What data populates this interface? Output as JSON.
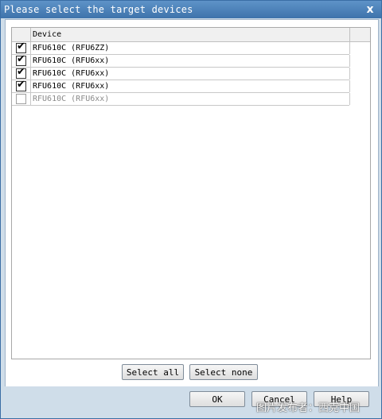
{
  "window": {
    "title": "Please select the target devices",
    "close_label": "x"
  },
  "list": {
    "header": "Device",
    "rows": [
      {
        "label": "RFU610C (RFU6ZZ)",
        "checked": true,
        "enabled": true
      },
      {
        "label": "RFU610C (RFU6xx)",
        "checked": true,
        "enabled": true
      },
      {
        "label": "RFU610C (RFU6xx)",
        "checked": true,
        "enabled": true
      },
      {
        "label": "RFU610C (RFU6xx)",
        "checked": true,
        "enabled": true
      },
      {
        "label": "RFU610C (RFU6xx)",
        "checked": false,
        "enabled": false
      }
    ]
  },
  "buttons": {
    "select_all": "Select all",
    "select_none": "Select none",
    "ok": "OK",
    "cancel": "Cancel",
    "help": "Help"
  },
  "watermark": "图片发布者：西克中国"
}
